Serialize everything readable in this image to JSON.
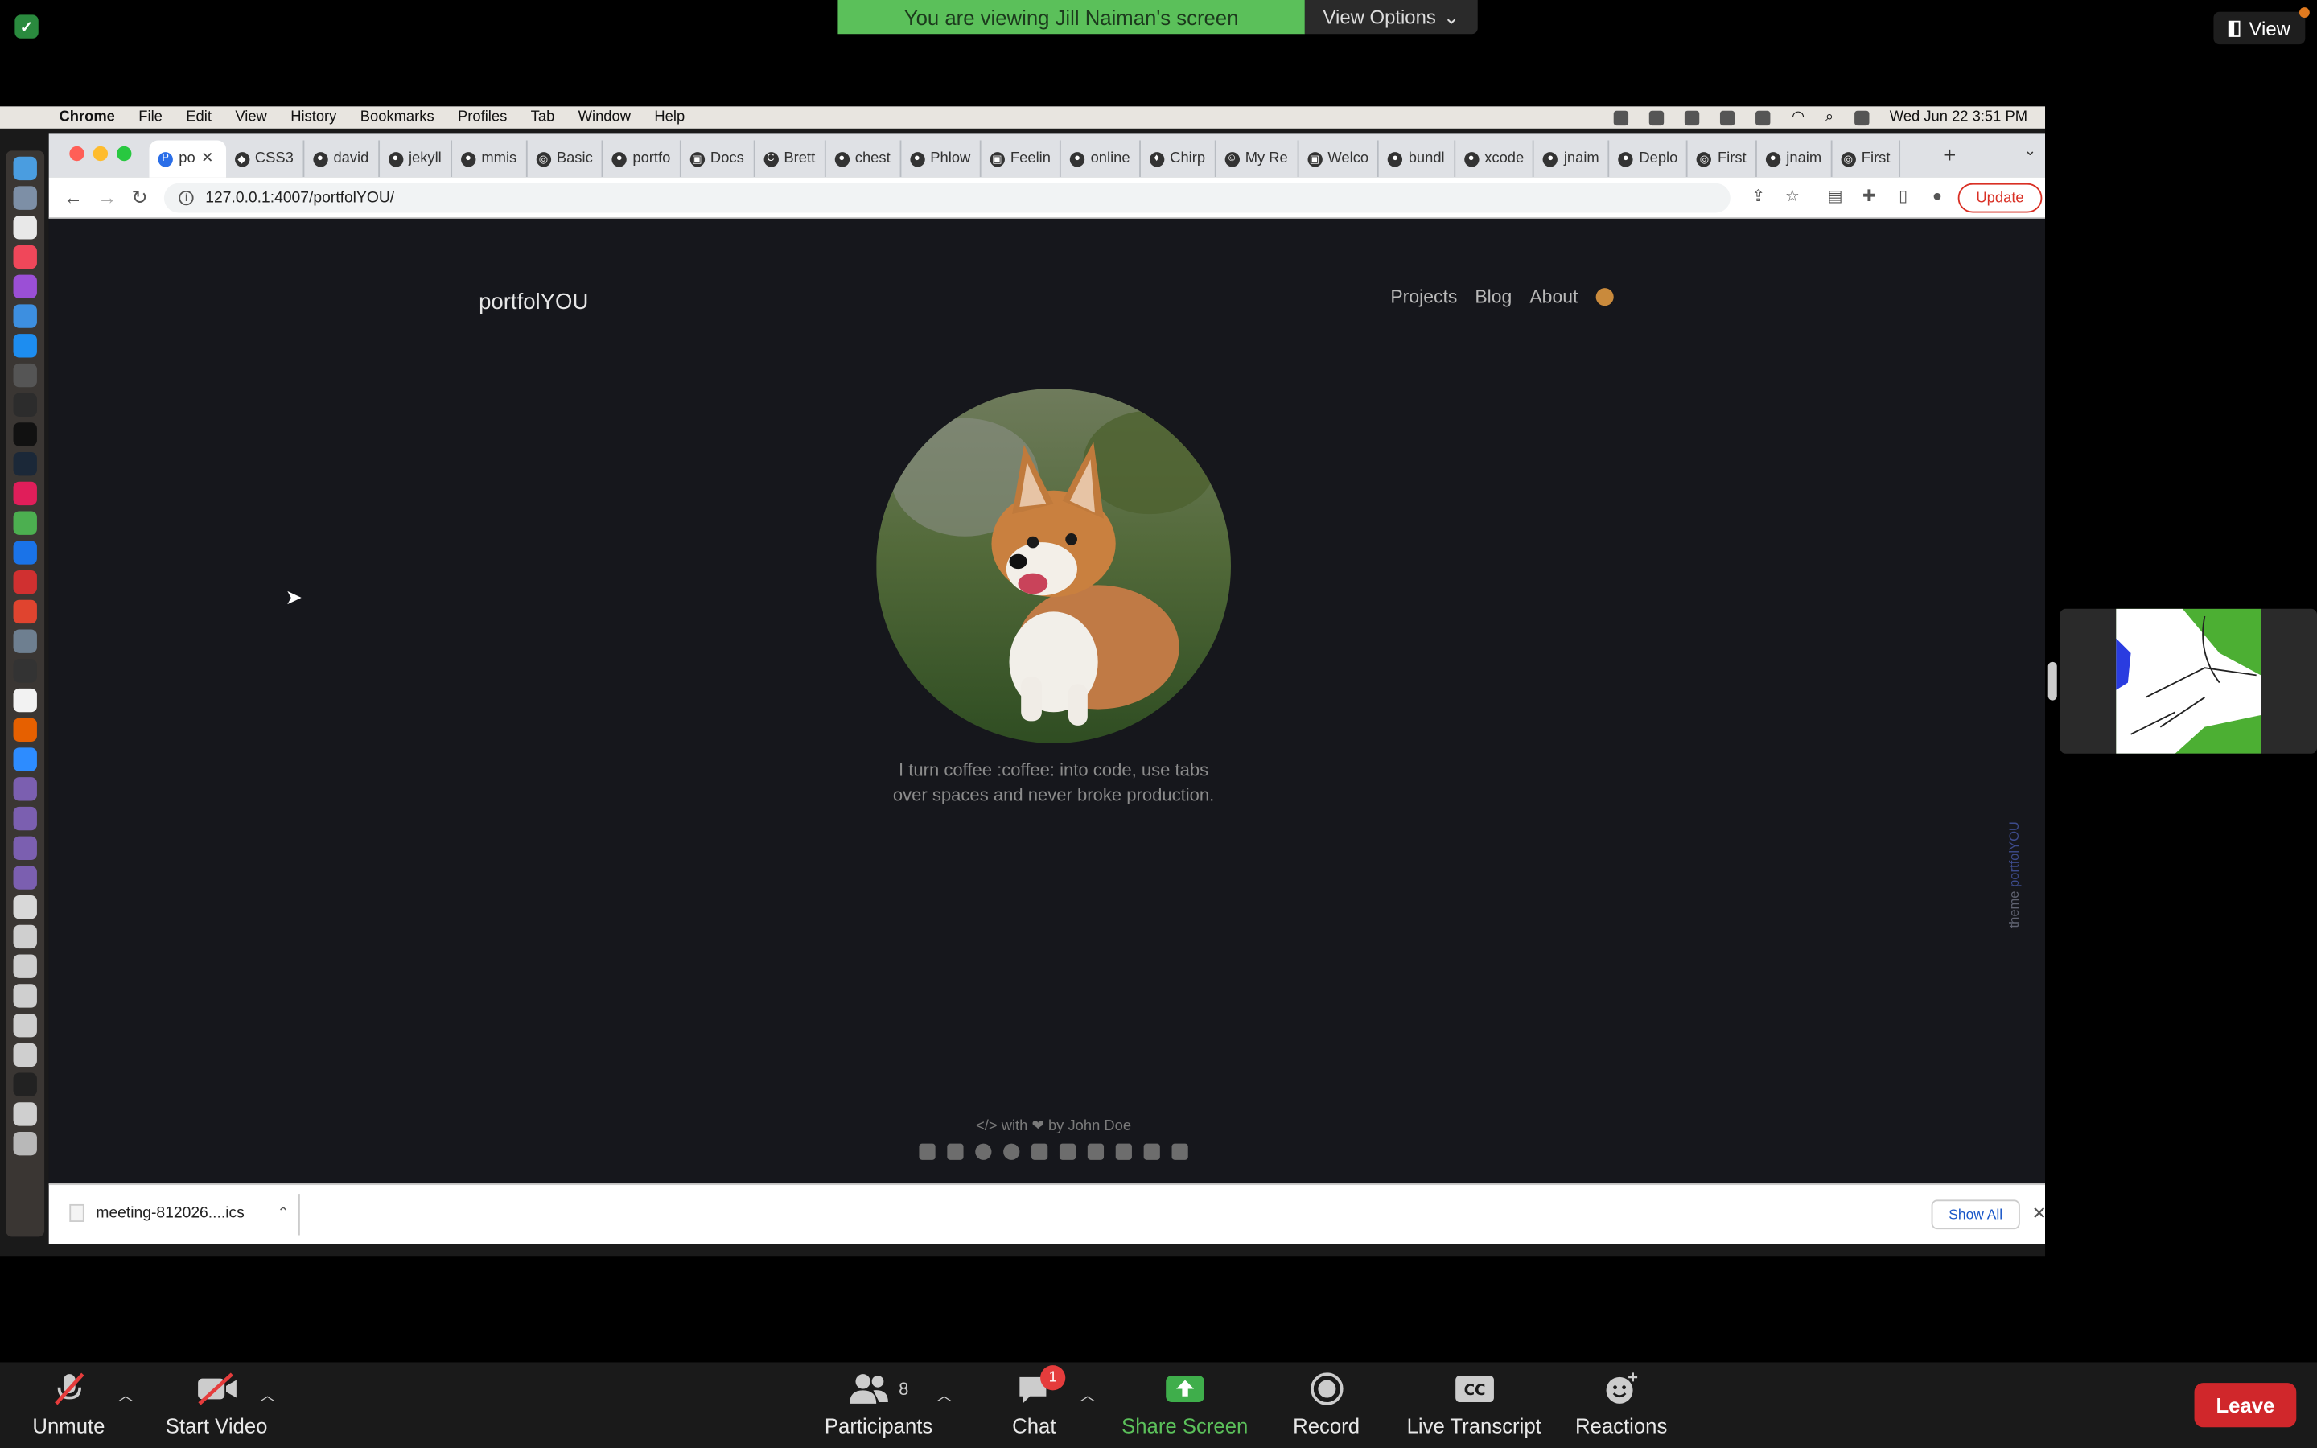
{
  "zoom_top": {
    "viewing_banner": "You are viewing Jill Naiman's screen",
    "view_options": "View Options",
    "view_label": "View"
  },
  "mac_menu": {
    "items": [
      "Chrome",
      "File",
      "Edit",
      "View",
      "History",
      "Bookmarks",
      "Profiles",
      "Tab",
      "Window",
      "Help"
    ],
    "clock": "Wed Jun 22  3:51 PM"
  },
  "browser": {
    "tabs": [
      "po",
      "CSS3",
      "david",
      "jekyll",
      "mmis",
      "Basic",
      "portfo",
      "Docs",
      "Brett",
      "chest",
      "Phlow",
      "Feelin",
      "online",
      "Chirp",
      "My Re",
      "Welco",
      "bundl",
      "xcode",
      "jnaim",
      "Deplo",
      "First",
      "jnaim",
      "First"
    ],
    "url": "127.0.0.1:4007/portfolYOU/",
    "update_label": "Update"
  },
  "page": {
    "brand": "portfolYOU",
    "nav": [
      "Projects",
      "Blog",
      "About"
    ],
    "bio_line1": "I turn coffee :coffee: into code, use tabs",
    "bio_line2": "over spaces and never broke production.",
    "theme_word": "theme",
    "theme_name": "portfolYOU",
    "footer": "</> with ❤ by John Doe"
  },
  "downloads": {
    "file": "meeting-812026....ics",
    "show_all": "Show All"
  },
  "zoom_bar": {
    "unmute": "Unmute",
    "start_video": "Start Video",
    "participants": "Participants",
    "participants_count": "8",
    "chat": "Chat",
    "chat_badge": "1",
    "share_screen": "Share Screen",
    "record": "Record",
    "live_transcript": "Live Transcript",
    "reactions": "Reactions",
    "leave": "Leave"
  },
  "colors": {
    "zoom_green": "#5bc05a",
    "leave_red": "#d0272b",
    "page_bg": "#16171c"
  }
}
